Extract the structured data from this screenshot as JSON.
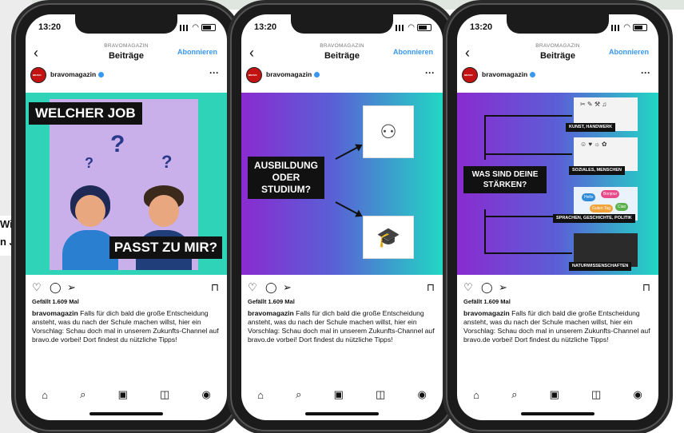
{
  "background": {
    "left_text_1": "Wie",
    "left_text_2": "n J"
  },
  "phones": [
    {
      "time": "13:20",
      "account_label": "BRAVOMAGAZIN",
      "title": "Beiträge",
      "follow": "Abonnieren",
      "username": "bravomagazin",
      "avatar_text": "BRAVO",
      "post_type": "job",
      "image": {
        "headline": "WELCHER JOB",
        "footer": "PASST ZU MIR?"
      },
      "likes": "Gefällt 1.609 Mal",
      "caption_user": "bravomagazin",
      "caption_text": " Falls für dich bald die große Entscheidung ansteht, was du nach der Schule machen willst, hier ein Vorschlag: Schau doch mal in unserem Zukunfts-Channel auf bravo.de vorbei! Dort findest du nützliche Tipps!"
    },
    {
      "time": "13:20",
      "account_label": "BRAVOMAGAZIN",
      "title": "Beiträge",
      "follow": "Abonnieren",
      "username": "bravomagazin",
      "avatar_text": "BRAVO",
      "post_type": "ausbildung",
      "image": {
        "headline": "AUSBILDUNG ODER STUDIUM?"
      },
      "likes": "Gefällt 1.609 Mal",
      "caption_user": "bravomagazin",
      "caption_text": " Falls für dich bald die große Entscheidung ansteht, was du nach der Schule machen willst, hier ein Vorschlag: Schau doch mal in unserem Zukunfts-Channel auf bravo.de vorbei! Dort findest du nützliche Tipps!"
    },
    {
      "time": "13:20",
      "account_label": "BRAVOMAGAZIN",
      "title": "Beiträge",
      "follow": "Abonnieren",
      "username": "bravomagazin",
      "avatar_text": "BRAVO",
      "post_type": "staerken",
      "image": {
        "headline": "WAS SIND DEINE STÄRKEN?",
        "categories": [
          "KUNST, HANDWERK",
          "SOZIALES, MENSCHEN",
          "SPRACHEN, GESCHICHTE, POLITIK",
          "NATURWISSENSCHAFTEN"
        ],
        "bubbles": [
          "Hello",
          "Bonjour",
          "Guten Tag",
          "Ciao"
        ]
      },
      "likes": "Gefällt 1.609 Mal",
      "caption_user": "bravomagazin",
      "caption_text": " Falls für dich bald die große Entscheidung ansteht, was du nach der Schule machen willst, hier ein Vorschlag: Schau doch mal in unserem Zukunfts-Channel auf bravo.de vorbei! Dort findest du nützliche Tipps!"
    }
  ],
  "colors": {
    "follow": "#3897f0",
    "teal": "#2ed3b8",
    "purple": "#8a2bd0",
    "avatar_red": "#c31212"
  },
  "icons": {
    "actions": [
      "heart-icon",
      "comment-icon",
      "share-icon",
      "bookmark-icon"
    ],
    "nav": [
      "home-icon",
      "search-icon",
      "reels-icon",
      "shop-icon",
      "profile-icon"
    ]
  }
}
